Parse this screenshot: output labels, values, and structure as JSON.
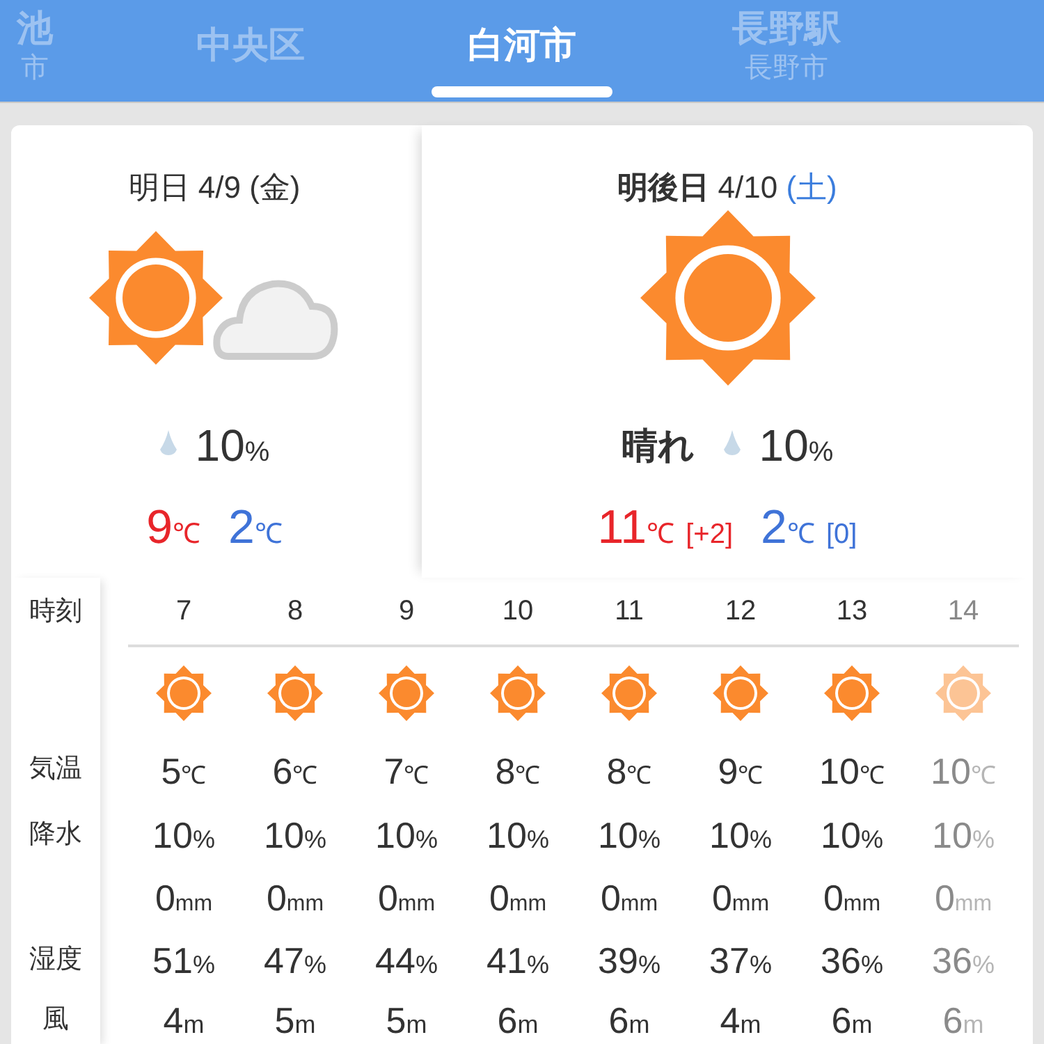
{
  "tabs": [
    {
      "label": "池",
      "sublabel": "市",
      "selected": false
    },
    {
      "label": "中央区",
      "selected": false
    },
    {
      "label": "白河市",
      "selected": true
    },
    {
      "label": "長野駅",
      "sublabel": "長野市",
      "selected": false
    }
  ],
  "days": [
    {
      "label": "明日",
      "emphasized": false,
      "date": "4/9",
      "weekday": {
        "text": "(金)",
        "color": "#333333"
      },
      "kind": "sunny_cloudy",
      "precip": {
        "value": "10",
        "unit": "%"
      },
      "high": {
        "value": "9",
        "unit": "℃"
      },
      "low": {
        "value": "2",
        "unit": "℃"
      }
    },
    {
      "label": "明後日",
      "emphasized": true,
      "date": "4/10",
      "weekday": {
        "text": "(土)",
        "color": "#3b7ddd"
      },
      "kind": "sunny",
      "condition": "晴れ",
      "precip": {
        "value": "10",
        "unit": "%"
      },
      "high": {
        "value": "11",
        "unit": "℃",
        "diff": "[+2]"
      },
      "low": {
        "value": "2",
        "unit": "℃",
        "diff": "[0]"
      }
    }
  ],
  "hourly": {
    "labels": {
      "hour": "時刻",
      "temp": "気温",
      "precip": "降水",
      "humidity": "湿度",
      "wind": "風"
    },
    "hours": [
      {
        "hour": "7",
        "kind": "sunny",
        "faded": false,
        "temp": {
          "value": "5",
          "unit": "℃"
        },
        "precip": {
          "value": "10",
          "unit": "%"
        },
        "rain": {
          "value": "0",
          "unit": "mm"
        },
        "humidity": {
          "value": "51",
          "unit": "%"
        },
        "wind": {
          "value": "4",
          "unit": "m"
        }
      },
      {
        "hour": "8",
        "kind": "sunny",
        "faded": false,
        "temp": {
          "value": "6",
          "unit": "℃"
        },
        "precip": {
          "value": "10",
          "unit": "%"
        },
        "rain": {
          "value": "0",
          "unit": "mm"
        },
        "humidity": {
          "value": "47",
          "unit": "%"
        },
        "wind": {
          "value": "5",
          "unit": "m"
        }
      },
      {
        "hour": "9",
        "kind": "sunny",
        "faded": false,
        "temp": {
          "value": "7",
          "unit": "℃"
        },
        "precip": {
          "value": "10",
          "unit": "%"
        },
        "rain": {
          "value": "0",
          "unit": "mm"
        },
        "humidity": {
          "value": "44",
          "unit": "%"
        },
        "wind": {
          "value": "5",
          "unit": "m"
        }
      },
      {
        "hour": "10",
        "kind": "sunny",
        "faded": false,
        "temp": {
          "value": "8",
          "unit": "℃"
        },
        "precip": {
          "value": "10",
          "unit": "%"
        },
        "rain": {
          "value": "0",
          "unit": "mm"
        },
        "humidity": {
          "value": "41",
          "unit": "%"
        },
        "wind": {
          "value": "6",
          "unit": "m"
        }
      },
      {
        "hour": "11",
        "kind": "sunny",
        "faded": false,
        "temp": {
          "value": "8",
          "unit": "℃"
        },
        "precip": {
          "value": "10",
          "unit": "%"
        },
        "rain": {
          "value": "0",
          "unit": "mm"
        },
        "humidity": {
          "value": "39",
          "unit": "%"
        },
        "wind": {
          "value": "6",
          "unit": "m"
        }
      },
      {
        "hour": "12",
        "kind": "sunny",
        "faded": false,
        "temp": {
          "value": "9",
          "unit": "℃"
        },
        "precip": {
          "value": "10",
          "unit": "%"
        },
        "rain": {
          "value": "0",
          "unit": "mm"
        },
        "humidity": {
          "value": "37",
          "unit": "%"
        },
        "wind": {
          "value": "4",
          "unit": "m"
        }
      },
      {
        "hour": "13",
        "kind": "sunny",
        "faded": false,
        "temp": {
          "value": "10",
          "unit": "℃"
        },
        "precip": {
          "value": "10",
          "unit": "%"
        },
        "rain": {
          "value": "0",
          "unit": "mm"
        },
        "humidity": {
          "value": "36",
          "unit": "%"
        },
        "wind": {
          "value": "6",
          "unit": "m"
        }
      },
      {
        "hour": "14",
        "kind": "sunny",
        "faded": true,
        "temp": {
          "value": "10",
          "unit": "℃"
        },
        "precip": {
          "value": "10",
          "unit": "%"
        },
        "rain": {
          "value": "0",
          "unit": "mm"
        },
        "humidity": {
          "value": "36",
          "unit": "%"
        },
        "wind": {
          "value": "6",
          "unit": "m"
        }
      }
    ]
  }
}
